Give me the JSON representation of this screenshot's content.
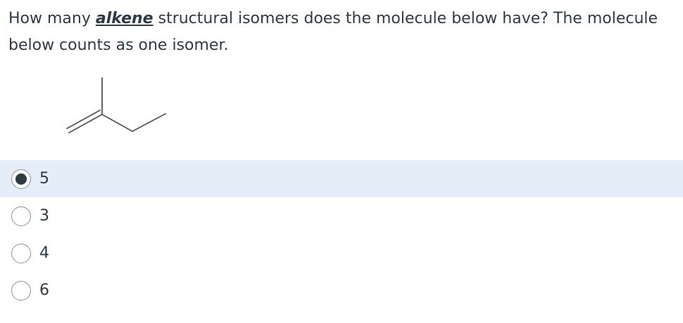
{
  "question": {
    "part1": "How many ",
    "emphasis": "alkene",
    "part2": " structural isomers does the molecule below have?  The molecule below counts as one isomer."
  },
  "options": [
    {
      "label": "5",
      "selected": true
    },
    {
      "label": "3",
      "selected": false
    },
    {
      "label": "4",
      "selected": false
    },
    {
      "label": "6",
      "selected": false
    }
  ]
}
